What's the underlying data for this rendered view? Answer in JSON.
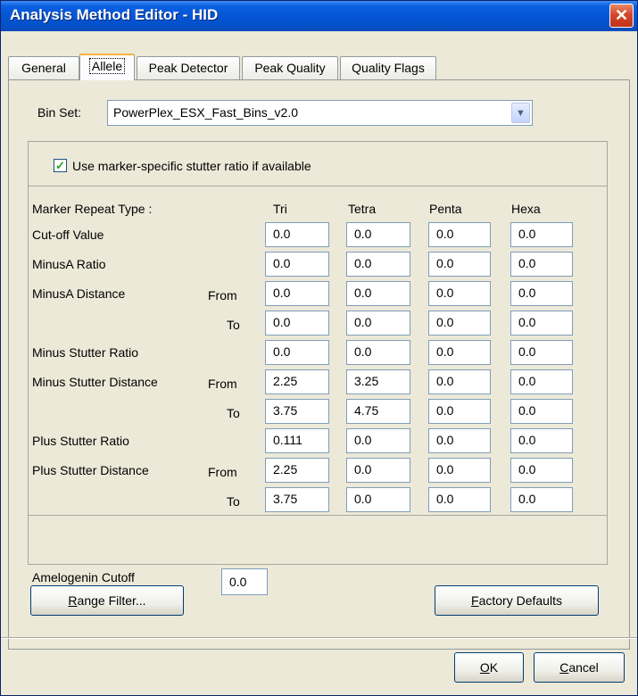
{
  "window": {
    "title": "Analysis Method Editor - HID",
    "close_glyph": "✕"
  },
  "tabs": [
    {
      "label": "General"
    },
    {
      "label": "Allele"
    },
    {
      "label": "Peak Detector"
    },
    {
      "label": "Peak Quality"
    },
    {
      "label": "Quality Flags"
    }
  ],
  "bin_set": {
    "label": "Bin Set:",
    "value": "PowerPlex_ESX_Fast_Bins_v2.0",
    "arrow": "▼"
  },
  "stutter_checkbox": {
    "label": "Use marker-specific stutter ratio if available",
    "checked": true,
    "mark": "✓"
  },
  "grid": {
    "header_label": "Marker Repeat Type :",
    "columns": [
      "Tri",
      "Tetra",
      "Penta",
      "Hexa"
    ],
    "rows": [
      {
        "label": "Cut-off Value",
        "sub": "",
        "values": [
          "0.0",
          "0.0",
          "0.0",
          "0.0"
        ]
      },
      {
        "label": "MinusA Ratio",
        "sub": "",
        "values": [
          "0.0",
          "0.0",
          "0.0",
          "0.0"
        ]
      },
      {
        "label": "MinusA Distance",
        "sub": "From",
        "values": [
          "0.0",
          "0.0",
          "0.0",
          "0.0"
        ]
      },
      {
        "label": "",
        "sub": "To",
        "values": [
          "0.0",
          "0.0",
          "0.0",
          "0.0"
        ]
      },
      {
        "label": "Minus Stutter Ratio",
        "sub": "",
        "values": [
          "0.0",
          "0.0",
          "0.0",
          "0.0"
        ]
      },
      {
        "label": "Minus Stutter Distance",
        "sub": "From",
        "values": [
          "2.25",
          "3.25",
          "0.0",
          "0.0"
        ]
      },
      {
        "label": "",
        "sub": "To",
        "values": [
          "3.75",
          "4.75",
          "0.0",
          "0.0"
        ]
      },
      {
        "label": "Plus Stutter Ratio",
        "sub": "",
        "values": [
          "0.111",
          "0.0",
          "0.0",
          "0.0"
        ]
      },
      {
        "label": "Plus Stutter Distance",
        "sub": "From",
        "values": [
          "2.25",
          "0.0",
          "0.0",
          "0.0"
        ]
      },
      {
        "label": "",
        "sub": "To",
        "values": [
          "3.75",
          "0.0",
          "0.0",
          "0.0"
        ]
      }
    ]
  },
  "amelogenin": {
    "label": "Amelogenin Cutoff",
    "value": "0.0"
  },
  "buttons": {
    "range_filter": {
      "mnemonic": "R",
      "rest": "ange Filter..."
    },
    "factory_defaults": {
      "mnemonic": "F",
      "rest": "actory Defaults"
    },
    "ok": {
      "mnemonic": "O",
      "rest": "K"
    },
    "cancel": {
      "mnemonic": "C",
      "rest": "ancel"
    }
  }
}
